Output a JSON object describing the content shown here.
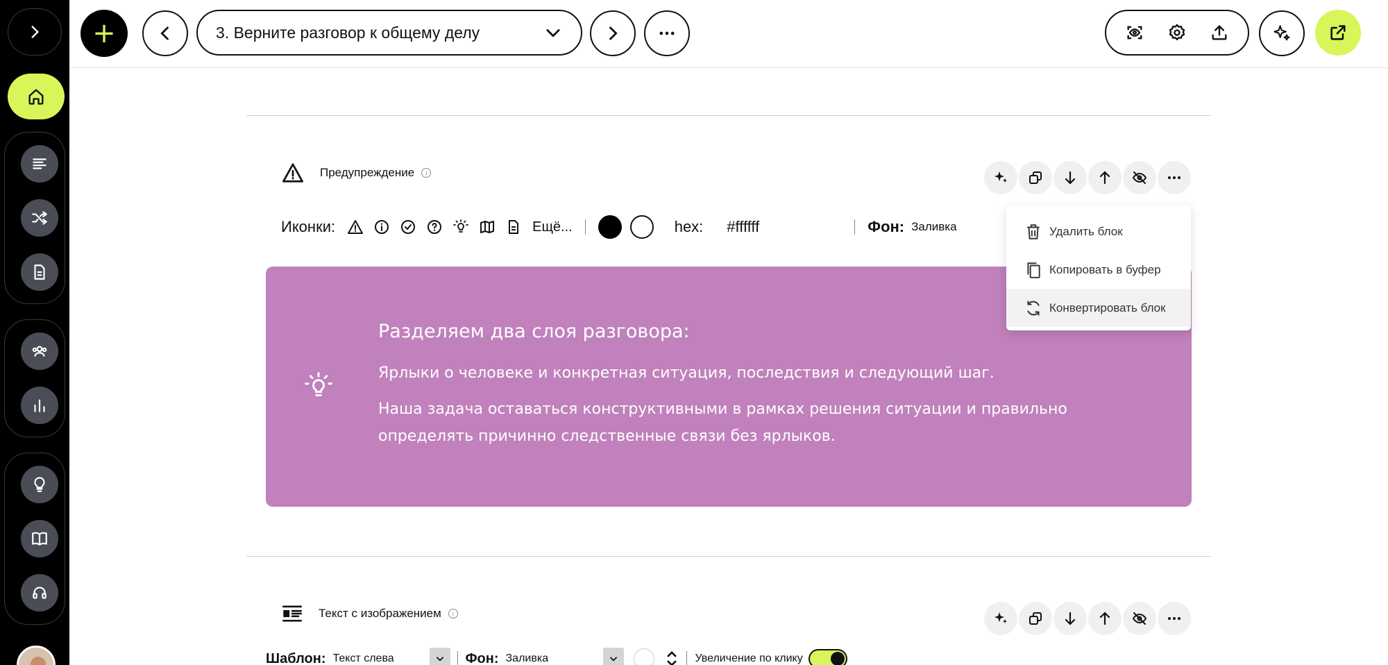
{
  "colors": {
    "accent": "#d8f55a",
    "callout_bg": "#c081bc",
    "sidebar_bg": "#000000"
  },
  "topbar": {
    "add_icon": "+",
    "lesson_title": "3. Верните разговор к общему делу"
  },
  "block1": {
    "title": "Предупреждение",
    "toolbar": {
      "icons_label": "Иконки:",
      "more": "Ещё...",
      "hex_label": "hex:",
      "hex_value": "#ffffff",
      "fon_label": "Фон:",
      "fon_value": "Заливка"
    },
    "callout": {
      "heading": "Разделяем два слоя разговора:",
      "line1": "Ярлыки о человеке и конкретная ситуация, последствия и следующий шаг.",
      "line2": "Наша задача оставаться конструктивными в рамках решения ситуации и правильно определять причинно следственные связи без ярлыков."
    }
  },
  "context_menu": {
    "items": [
      {
        "label": "Удалить блок",
        "icon": "trash-icon"
      },
      {
        "label": "Копировать в буфер",
        "icon": "copy-icon"
      },
      {
        "label": "Конвертировать блок",
        "icon": "convert-icon"
      }
    ]
  },
  "block2": {
    "title": "Текст с изображением",
    "toolbar": {
      "template_label": "Шаблон:",
      "template_value": "Текст слева",
      "fon_label": "Фон:",
      "fon_value": "Заливка",
      "zoom_label": "Увеличение по клику"
    }
  }
}
